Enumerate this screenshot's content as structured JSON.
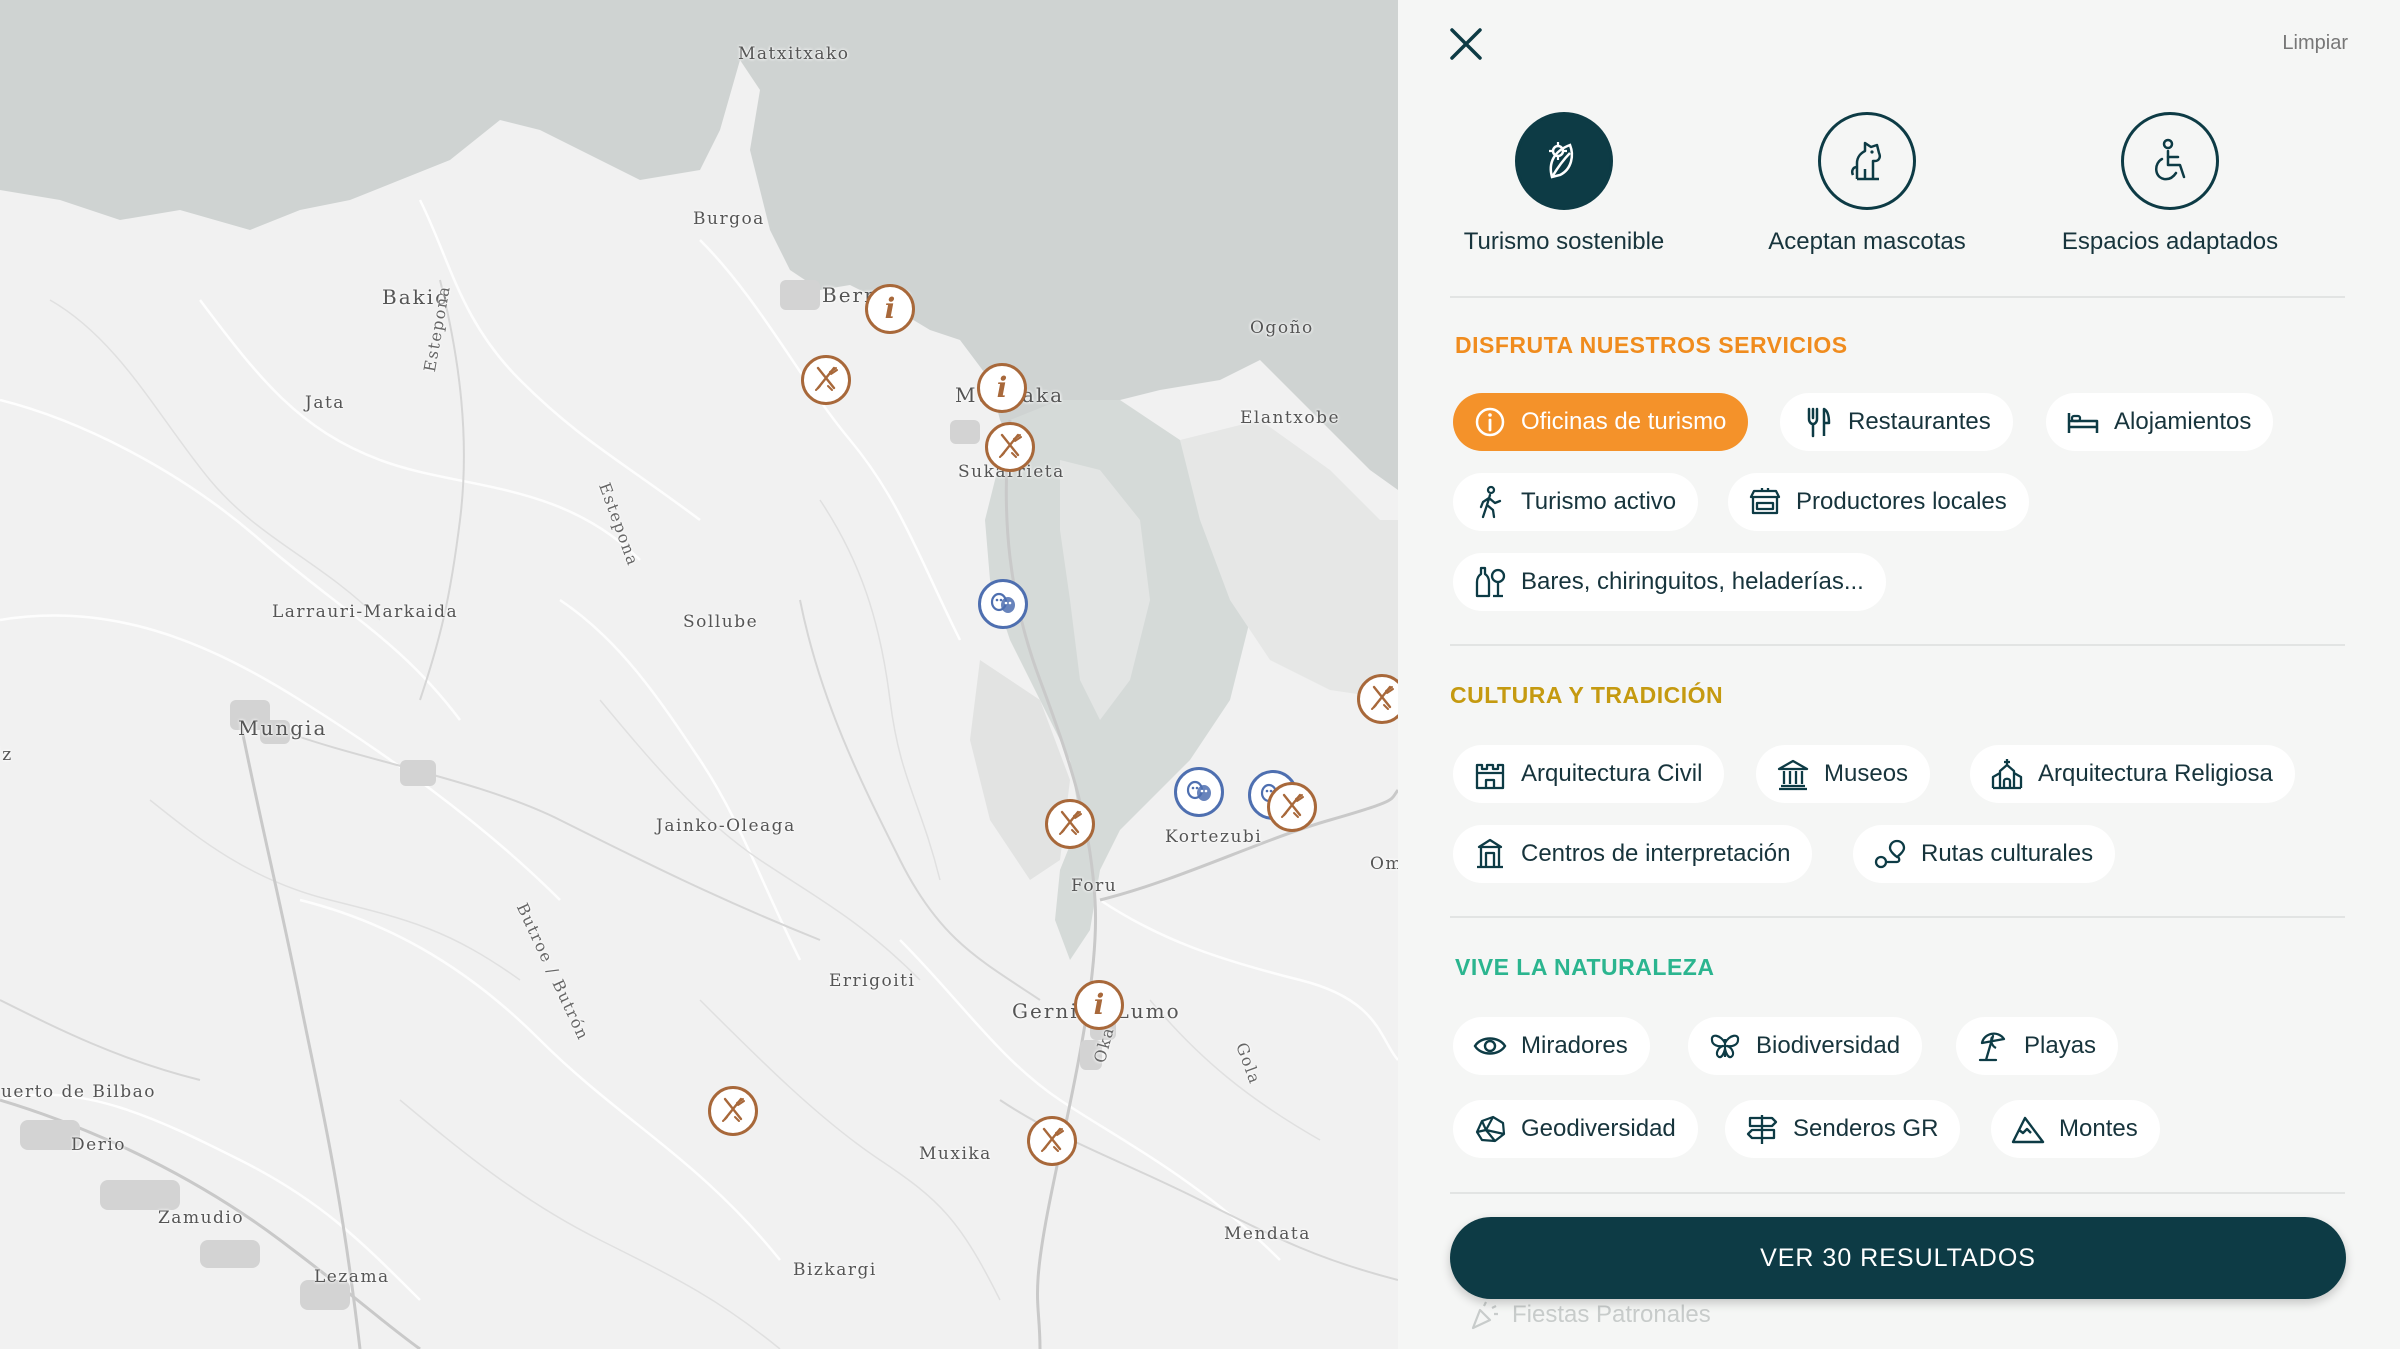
{
  "map": {
    "places": [
      {
        "name": "Matxitxako",
        "cls": ""
      },
      {
        "name": "Burgoa",
        "cls": ""
      },
      {
        "name": "Bakio",
        "cls": "big"
      },
      {
        "name": "Bermeo",
        "cls": "big"
      },
      {
        "name": "Ogoño",
        "cls": ""
      },
      {
        "name": "Jata",
        "cls": ""
      },
      {
        "name": "Estepona",
        "cls": "road"
      },
      {
        "name": "Estepona",
        "cls": "road"
      },
      {
        "name": "Mundaka",
        "cls": "big"
      },
      {
        "name": "Elantxobe",
        "cls": ""
      },
      {
        "name": "Sukarrieta",
        "cls": ""
      },
      {
        "name": "Larrauri-Markaida",
        "cls": ""
      },
      {
        "name": "Sollube",
        "cls": ""
      },
      {
        "name": "Mungia",
        "cls": "big"
      },
      {
        "name": "Jainko-Oleaga",
        "cls": ""
      },
      {
        "name": "Butroe / Butrón",
        "cls": "road"
      },
      {
        "name": "Kortezubi",
        "cls": ""
      },
      {
        "name": "Foru",
        "cls": ""
      },
      {
        "name": "Errigoiti",
        "cls": ""
      },
      {
        "name": "Gernika-Lumo",
        "cls": "big"
      },
      {
        "name": "Oka",
        "cls": "road"
      },
      {
        "name": "Gola",
        "cls": "road"
      },
      {
        "name": "Puerto de Bilbao",
        "cls": ""
      },
      {
        "name": "Derio",
        "cls": ""
      },
      {
        "name": "Muxika",
        "cls": ""
      },
      {
        "name": "Zamudio",
        "cls": ""
      },
      {
        "name": "Lezama",
        "cls": ""
      },
      {
        "name": "Mendata",
        "cls": ""
      },
      {
        "name": "Bizkargi",
        "cls": ""
      },
      {
        "name": "Iz",
        "cls": ""
      },
      {
        "name": "Om",
        "cls": ""
      }
    ],
    "markers": [
      {
        "type": "info",
        "label": "Oficina de turismo"
      },
      {
        "type": "restaurant",
        "label": "Restaurante"
      },
      {
        "type": "info",
        "label": "Oficina de turismo"
      },
      {
        "type": "restaurant",
        "label": "Restaurante"
      },
      {
        "type": "theatre",
        "label": "Cultura"
      },
      {
        "type": "restaurant",
        "label": "Restaurante"
      },
      {
        "type": "restaurant",
        "label": "Restaurante"
      },
      {
        "type": "theatre",
        "label": "Cultura"
      },
      {
        "type": "theatre",
        "label": "Cultura"
      },
      {
        "type": "restaurant",
        "label": "Restaurante"
      },
      {
        "type": "info",
        "label": "Oficina de turismo"
      },
      {
        "type": "restaurant",
        "label": "Restaurante"
      },
      {
        "type": "restaurant",
        "label": "Restaurante"
      }
    ]
  },
  "panel": {
    "close_icon": "close-icon",
    "clear_label": "Limpiar",
    "features": [
      {
        "label": "Turismo sostenible",
        "icon": "sustainable-leaf-icon",
        "active": true
      },
      {
        "label": "Aceptan mascotas",
        "icon": "dog-icon",
        "active": false
      },
      {
        "label": "Espacios adaptados",
        "icon": "wheelchair-icon",
        "active": false
      }
    ],
    "sections": [
      {
        "title": "DISFRUTA NUESTROS SERVICIOS",
        "color": "#f08c1e",
        "chips": [
          {
            "label": "Oficinas de turismo",
            "icon": "info-icon",
            "active": true
          },
          {
            "label": "Restaurantes",
            "icon": "fork-knife-icon",
            "active": false
          },
          {
            "label": "Alojamientos",
            "icon": "bed-icon",
            "active": false
          },
          {
            "label": "Turismo activo",
            "icon": "hiker-icon",
            "active": false
          },
          {
            "label": "Productores locales",
            "icon": "market-stall-icon",
            "active": false
          },
          {
            "label": "Bares, chiringuitos, heladerías...",
            "icon": "bottle-icon",
            "active": false
          }
        ]
      },
      {
        "title": "CULTURA Y TRADICIÓN",
        "color": "#c59a10",
        "chips": [
          {
            "label": "Arquitectura Civil",
            "icon": "castle-icon",
            "active": false
          },
          {
            "label": "Museos",
            "icon": "museum-icon",
            "active": false
          },
          {
            "label": "Arquitectura Religiosa",
            "icon": "church-icon",
            "active": false
          },
          {
            "label": "Centros de interpretación",
            "icon": "building-icon",
            "active": false
          },
          {
            "label": "Rutas culturales",
            "icon": "route-icon",
            "active": false
          }
        ]
      },
      {
        "title": "VIVE LA NATURALEZA",
        "color": "#2bb58f",
        "chips": [
          {
            "label": "Miradores",
            "icon": "eye-icon",
            "active": false
          },
          {
            "label": "Biodiversidad",
            "icon": "butterfly-icon",
            "active": false
          },
          {
            "label": "Playas",
            "icon": "beach-umbrella-icon",
            "active": false
          },
          {
            "label": "Geodiversidad",
            "icon": "rock-icon",
            "active": false
          },
          {
            "label": "Senderos GR",
            "icon": "signpost-icon",
            "active": false
          },
          {
            "label": "Montes",
            "icon": "mountain-icon",
            "active": false
          }
        ]
      }
    ],
    "results_button": "VER 30 RESULTADOS",
    "faded_item": "Fiestas Patronales"
  }
}
